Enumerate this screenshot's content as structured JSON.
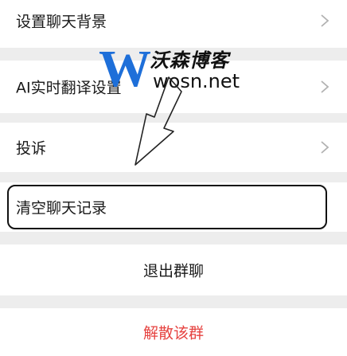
{
  "settings": {
    "items": [
      {
        "label": "设置聊天背景"
      },
      {
        "label": "AI实时翻译设置"
      },
      {
        "label": "投诉"
      },
      {
        "label": "清空聊天记录"
      }
    ],
    "exit_label": "退出群聊",
    "dissolve_label": "解散该群"
  },
  "watermark": {
    "brand": "沃森博客",
    "url": "wosn.net",
    "logo_letter": "W"
  },
  "colors": {
    "background": "#ededed",
    "row": "#ffffff",
    "danger": "#e64340",
    "logo_blue": "#1e6fd9"
  },
  "icons": [
    "chevron-right-icon",
    "arrow-down-icon",
    "wosn-logo-icon"
  ]
}
